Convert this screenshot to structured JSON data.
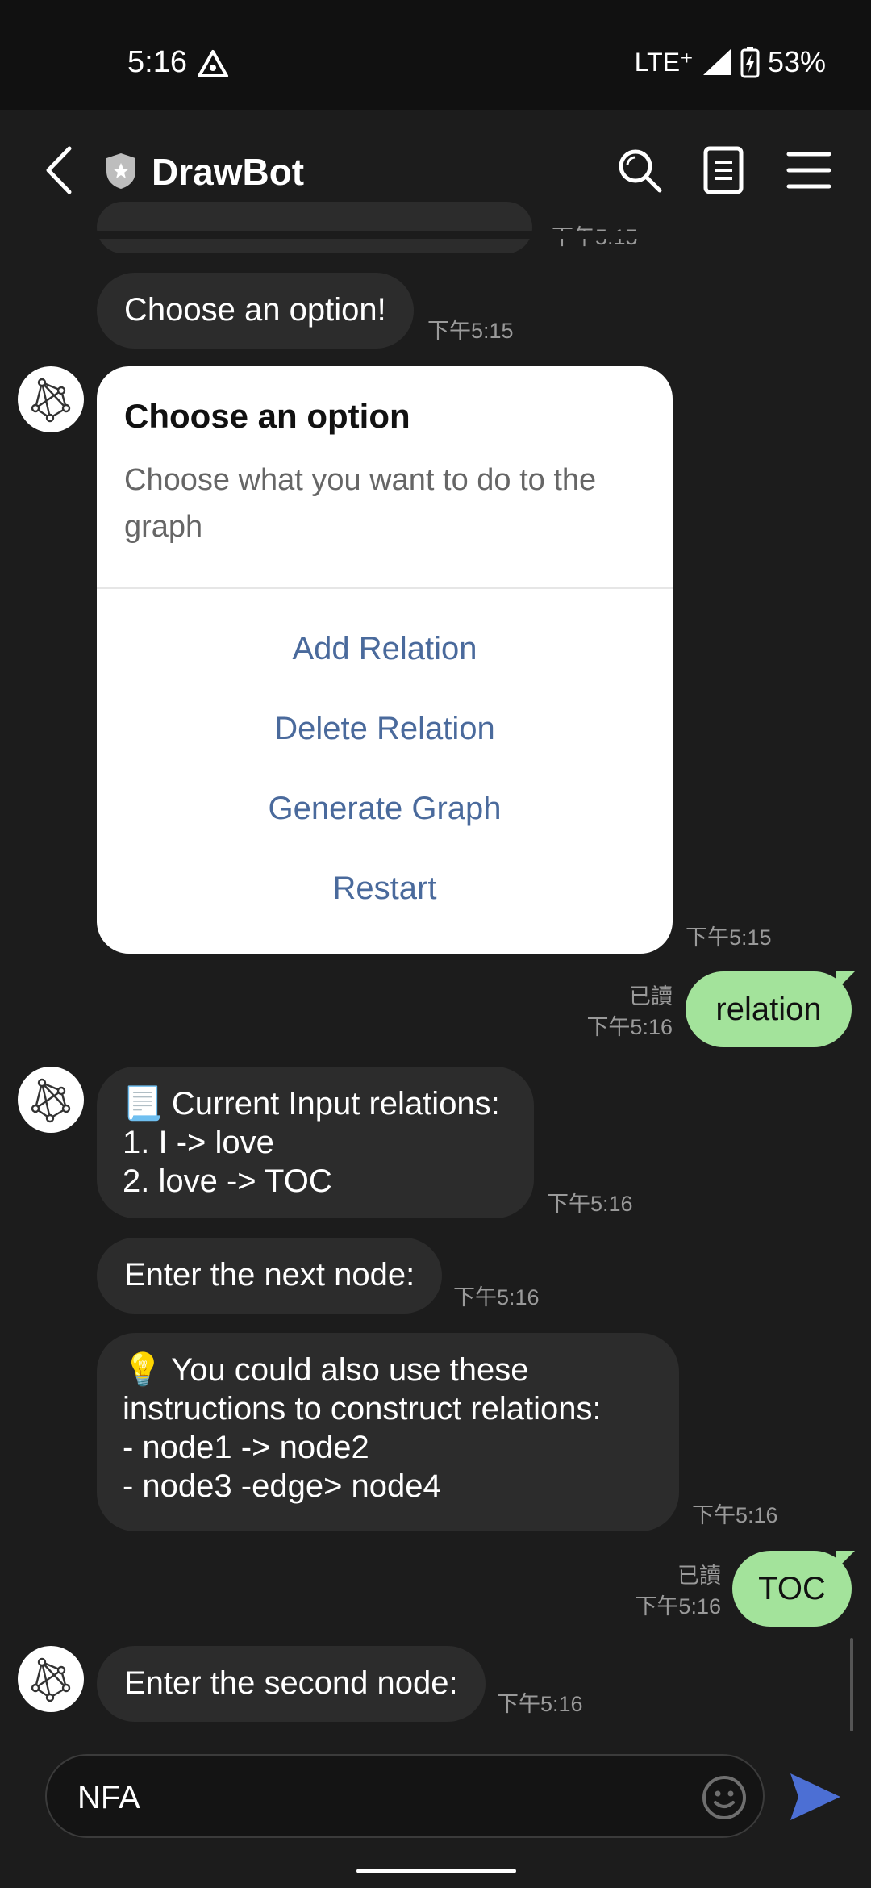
{
  "status_bar": {
    "time": "5:16",
    "network": "LTE⁺",
    "battery": "53%"
  },
  "header": {
    "title": "DrawBot"
  },
  "messages": {
    "partial_timestamp": "下午5:15",
    "m1": {
      "text": "Choose an option!",
      "time": "下午5:15"
    },
    "card": {
      "title": "Choose an option",
      "description": "Choose what you want to do to the graph",
      "actions": [
        "Add Relation",
        "Delete Relation",
        "Generate Graph",
        "Restart"
      ],
      "time": "下午5:15"
    },
    "u1": {
      "text": "relation",
      "read": "已讀",
      "time": "下午5:16"
    },
    "m2": {
      "text": "📃 Current Input relations:\n1.  I -> love\n2.  love -> TOC",
      "time": "下午5:16"
    },
    "m3": {
      "text": "Enter the next node:",
      "time": "下午5:16"
    },
    "m4": {
      "text": "💡 You could also use these\ninstructions to construct relations:\n- node1 -> node2\n- node3 -edge> node4",
      "time": "下午5:16"
    },
    "u2": {
      "text": "TOC",
      "read": "已讀",
      "time": "下午5:16"
    },
    "m5": {
      "text": "Enter the second node:",
      "time": "下午5:16"
    }
  },
  "input": {
    "value": "NFA"
  },
  "colors": {
    "user_bubble": "#a3e39b",
    "bot_bubble": "#2c2c2c",
    "link": "#4a6a9c",
    "send": "#4c6fd4"
  },
  "icons": [
    "back-icon",
    "shield-icon",
    "search-icon",
    "notes-icon",
    "menu-icon",
    "graph-avatar-icon",
    "emoji-icon",
    "send-icon"
  ]
}
